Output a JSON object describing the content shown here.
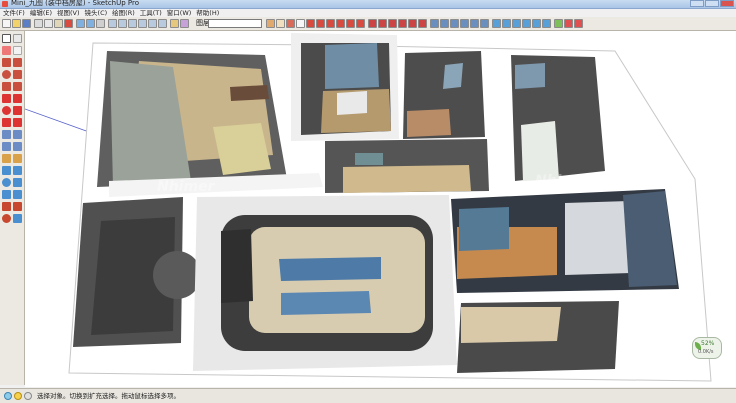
{
  "window": {
    "title": "Mini_九图 (装中档房屋) - SketchUp Pro"
  },
  "menu": [
    "文件(F)",
    "编辑(E)",
    "视图(V)",
    "镜头(C)",
    "绘图(R)",
    "工具(T)",
    "窗口(W)",
    "帮助(H)"
  ],
  "toolbar": {
    "layer_label": "图层",
    "layer_value": ""
  },
  "statusbar": {
    "message": "选择对象。切换到扩充选择。拖动鼠标选择多项。"
  },
  "status_badge": {
    "percent": "52%",
    "label": "0.0K/s"
  },
  "watermarks": [
    "Nhimer",
    "Nhimer"
  ]
}
